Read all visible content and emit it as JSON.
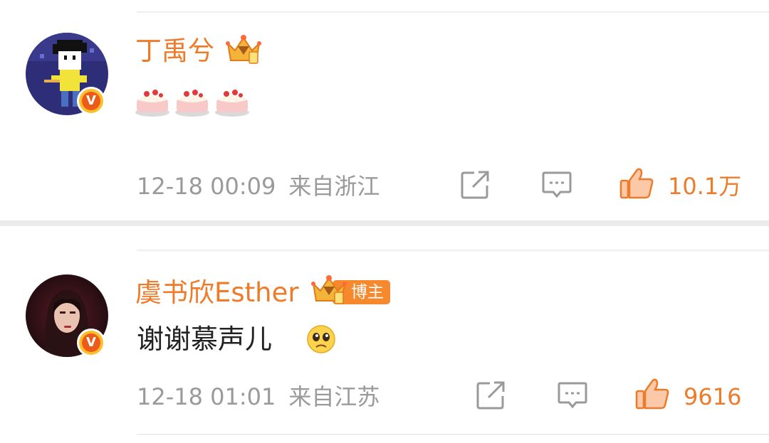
{
  "comments": [
    {
      "username": "丁禹兮",
      "verified_mark": "V",
      "text": "",
      "emojis": [
        "cake-emoji",
        "cake-emoji",
        "cake-emoji"
      ],
      "time": "12-18 00:09",
      "location": "来自浙江",
      "likes": "10.1万"
    },
    {
      "username": "虞书欣Esther",
      "verified_mark": "V",
      "badge": "博主",
      "text": "谢谢慕声儿",
      "emojis": [
        "pleading-face-emoji"
      ],
      "time": "12-18 01:01",
      "location": "来自江苏",
      "likes": "9616"
    }
  ],
  "colors": {
    "accent_orange": "#ee7b2a",
    "meta_gray": "#9a9a9a",
    "badge_orange": "#f6892e"
  },
  "icons": [
    "share-icon",
    "reply-icon",
    "like-icon",
    "crown-icon",
    "verified-badge-icon"
  ]
}
